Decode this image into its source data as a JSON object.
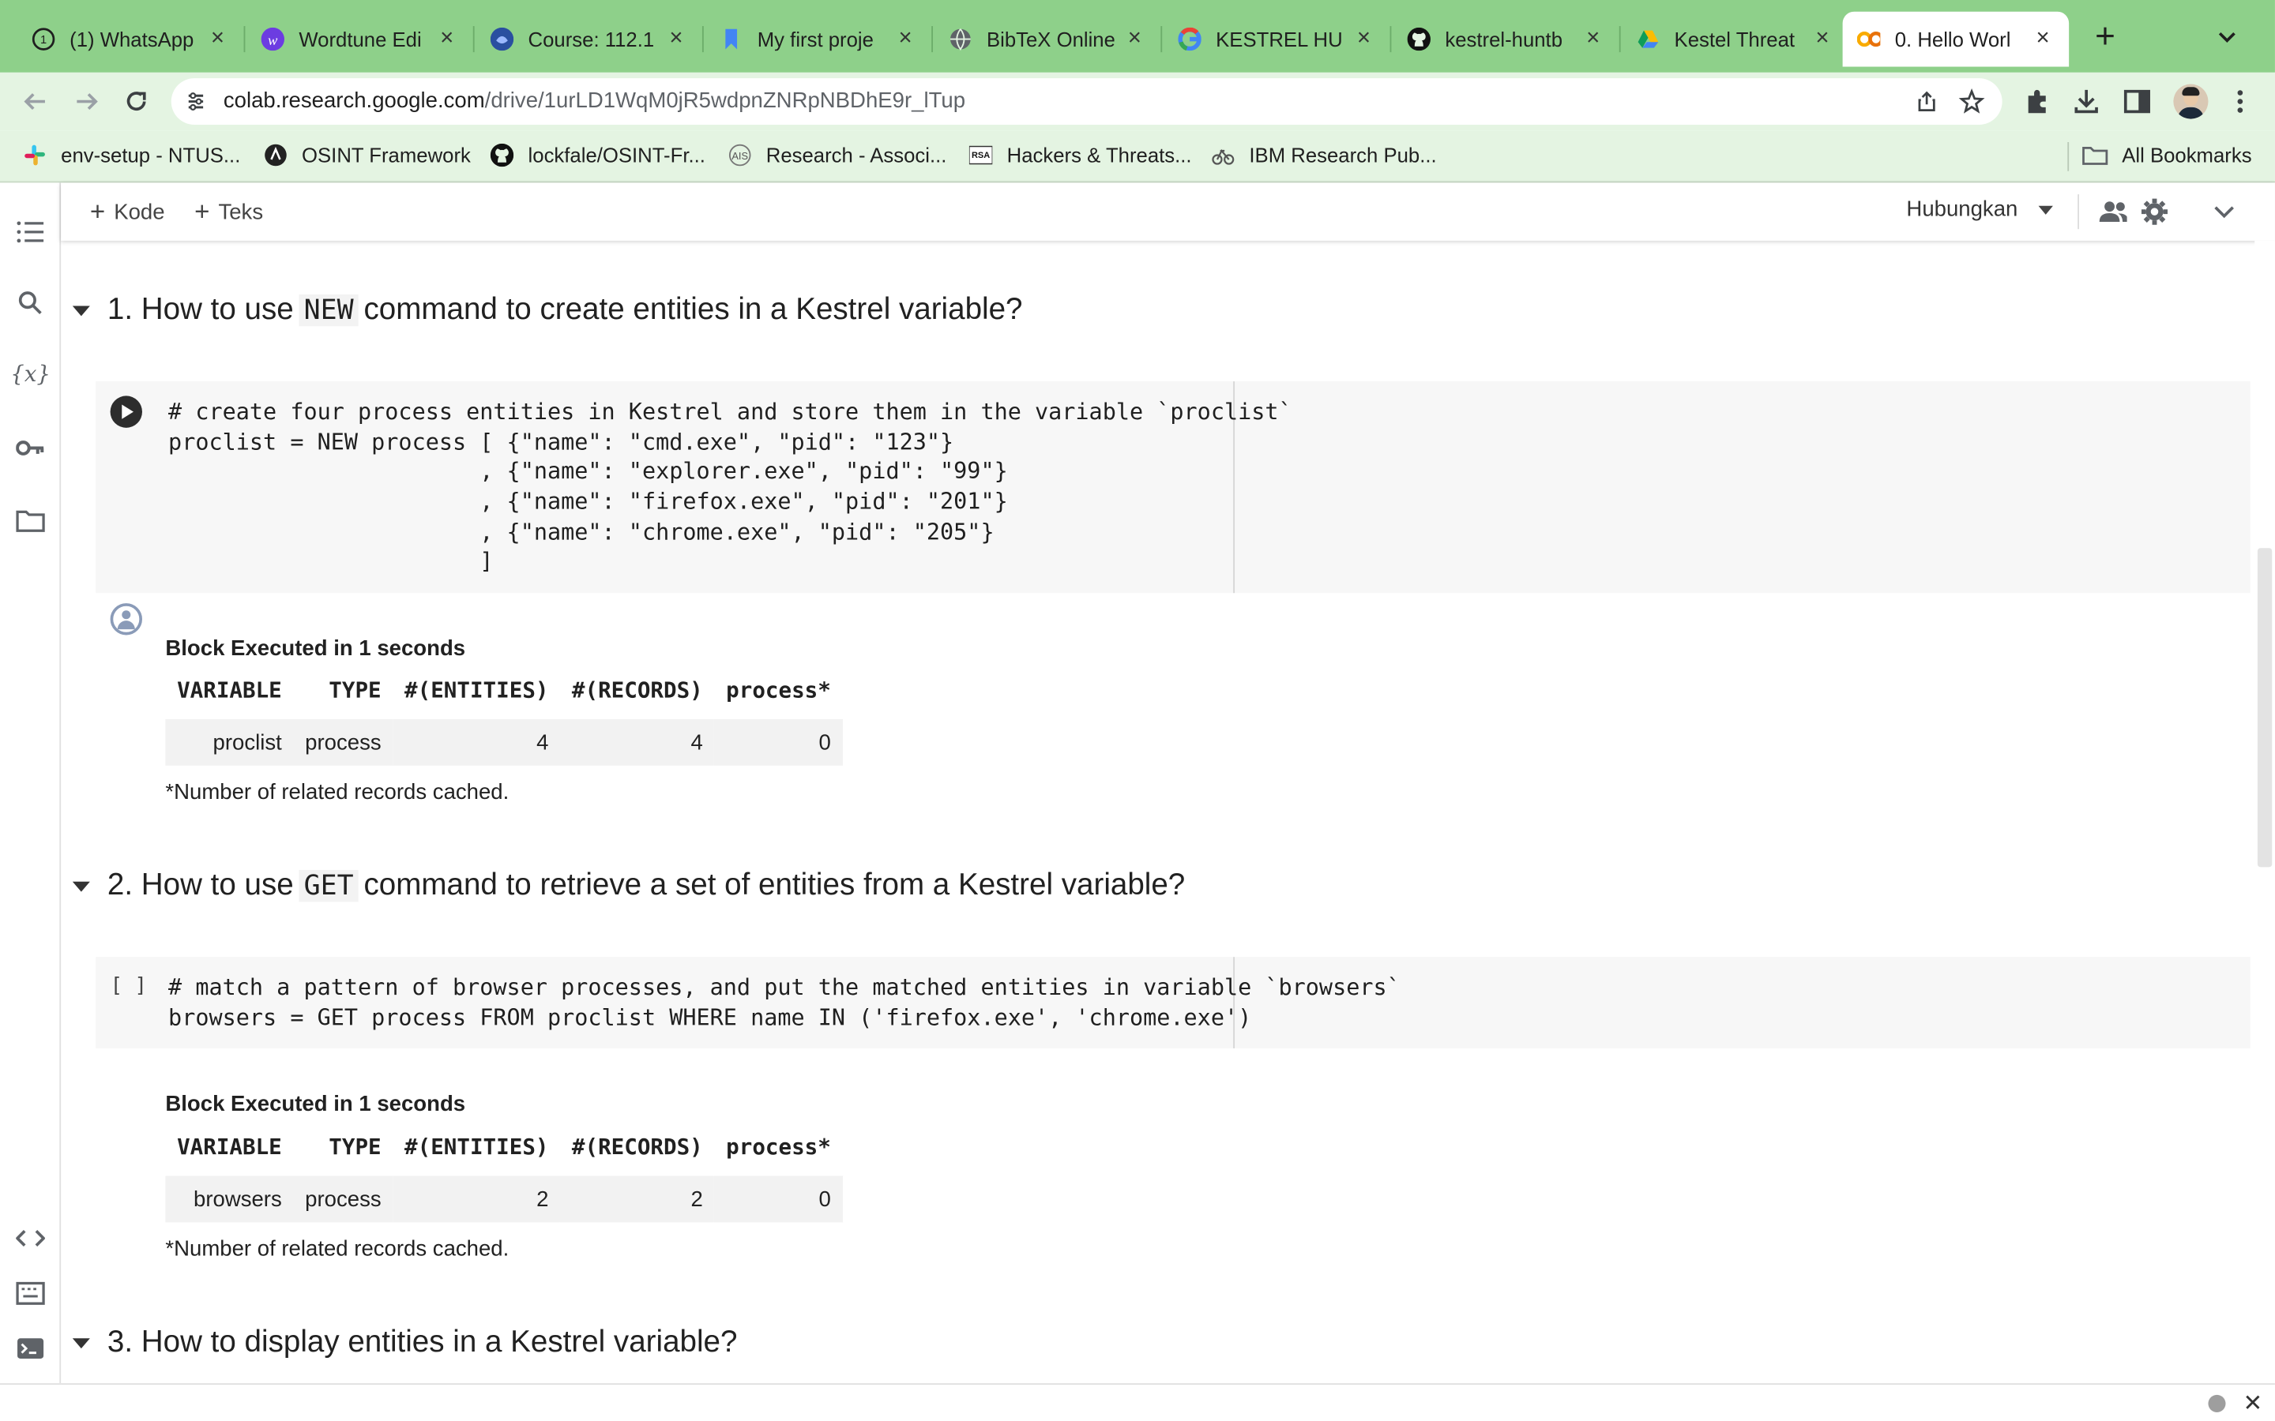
{
  "browser": {
    "tabs": [
      {
        "title": "(1) WhatsApp",
        "icon": "whatsapp-icon",
        "color": "#25d366"
      },
      {
        "title": "Wordtune Edi",
        "icon": "wordtune-icon",
        "color": "#6c3ce1"
      },
      {
        "title": "Course: 112.1",
        "icon": "course-icon",
        "color": "#2a4fa0"
      },
      {
        "title": "My first proje",
        "icon": "bookmark-icon",
        "color": "#4285f4"
      },
      {
        "title": "BibTeX Online",
        "icon": "globe-icon",
        "color": "#5f6368"
      },
      {
        "title": "KESTREL HU",
        "icon": "google-icon",
        "color": "#4285f4"
      },
      {
        "title": "kestrel-huntb",
        "icon": "github-icon",
        "color": "#111111"
      },
      {
        "title": "Kestel Threat",
        "icon": "drive-icon",
        "color": "#0f9d58"
      },
      {
        "title": "0. Hello Worl",
        "icon": "colab-icon",
        "color": "#f9ab00"
      }
    ],
    "url_domain": "colab.research.google.com",
    "url_path": "/drive/1urLD1WqM0jR5wdpnZNRpNBDhE9r_lTup",
    "bookmarks": [
      {
        "label": "env-setup - NTUS...",
        "icon": "slack-icon"
      },
      {
        "label": "OSINT Framework",
        "icon": "osint-icon"
      },
      {
        "label": "lockfale/OSINT-Fr...",
        "icon": "github-icon"
      },
      {
        "label": "Research - Associ...",
        "icon": "research-icon"
      },
      {
        "label": "Hackers & Threats...",
        "icon": "rsa-icon"
      },
      {
        "label": "IBM Research Pub...",
        "icon": "ibm-icon"
      }
    ],
    "all_bookmarks": "All Bookmarks"
  },
  "colab": {
    "add_code": "Kode",
    "add_text": "Teks",
    "connect": "Hubungkan"
  },
  "sections": [
    {
      "num": "1. How to use",
      "code": "NEW",
      "rest": "command to create entities in a Kestrel variable?"
    },
    {
      "num": "2. How to use",
      "code": "GET",
      "rest": "command to retrieve a set of entities from a Kestrel variable?"
    },
    {
      "title": "3. How to display entities in a Kestrel variable?"
    }
  ],
  "cells": [
    {
      "prompt": "",
      "lines": [
        "# create four process entities in Kestrel and store them in the variable `proclist`",
        "proclist = NEW process [ {\"name\": \"cmd.exe\", \"pid\": \"123\"}",
        "                       , {\"name\": \"explorer.exe\", \"pid\": \"99\"}",
        "                       , {\"name\": \"firefox.exe\", \"pid\": \"201\"}",
        "                       , {\"name\": \"chrome.exe\", \"pid\": \"205\"}",
        "                       ]"
      ]
    },
    {
      "prompt": "[ ]",
      "lines": [
        "# match a pattern of browser processes, and put the matched entities in variable `browsers`",
        "browsers = GET process FROM proclist WHERE name IN ('firefox.exe', 'chrome.exe')"
      ]
    }
  ],
  "outputs": [
    {
      "exec": "Block Executed in 1 seconds",
      "headers": [
        "VARIABLE",
        "TYPE",
        "#(ENTITIES)",
        "#(RECORDS)",
        "process*"
      ],
      "row": [
        "proclist",
        "process",
        "4",
        "4",
        "0"
      ],
      "note": "*Number of related records cached."
    },
    {
      "exec": "Block Executed in 1 seconds",
      "headers": [
        "VARIABLE",
        "TYPE",
        "#(ENTITIES)",
        "#(RECORDS)",
        "process*"
      ],
      "row": [
        "browsers",
        "process",
        "2",
        "2",
        "0"
      ],
      "note": "*Number of related records cached."
    }
  ]
}
